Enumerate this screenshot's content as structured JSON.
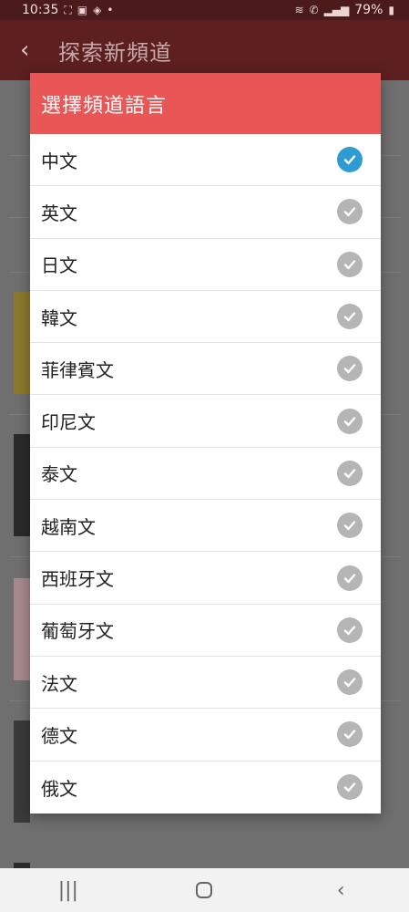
{
  "status_bar": {
    "time": "10:35",
    "battery": "79%"
  },
  "app_bar": {
    "back_icon": "back-arrow-icon",
    "title": "探索新頻道"
  },
  "dialog": {
    "title": "選擇頻道語言",
    "languages": [
      {
        "label": "中文",
        "selected": true
      },
      {
        "label": "英文",
        "selected": false
      },
      {
        "label": "日文",
        "selected": false
      },
      {
        "label": "韓文",
        "selected": false
      },
      {
        "label": "菲律賓文",
        "selected": false
      },
      {
        "label": "印尼文",
        "selected": false
      },
      {
        "label": "泰文",
        "selected": false
      },
      {
        "label": "越南文",
        "selected": false
      },
      {
        "label": "西班牙文",
        "selected": false
      },
      {
        "label": "葡萄牙文",
        "selected": false
      },
      {
        "label": "法文",
        "selected": false
      },
      {
        "label": "德文",
        "selected": false
      },
      {
        "label": "俄文",
        "selected": false
      }
    ],
    "colors": {
      "header": "#e85656",
      "check_selected": "#2f9bd3",
      "check_unselected": "#b5b5b5"
    }
  },
  "nav_bar": {
    "recents_icon": "recents-icon",
    "home_icon": "home-icon",
    "back_icon": "nav-back-icon"
  }
}
